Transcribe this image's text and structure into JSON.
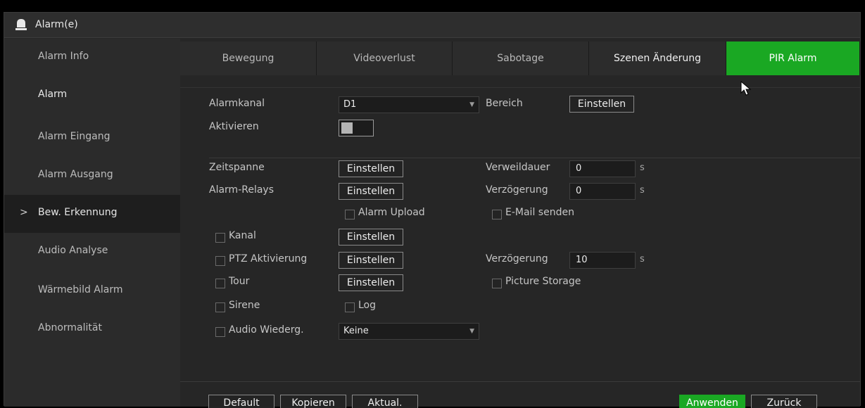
{
  "window": {
    "title": "Alarm(e)"
  },
  "sidebar": {
    "items": [
      {
        "label": "Alarm Info"
      },
      {
        "label": "Alarm"
      },
      {
        "label": "Alarm Eingang"
      },
      {
        "label": "Alarm Ausgang"
      },
      {
        "label": "Bew. Erkennung",
        "active": true
      },
      {
        "label": "Audio Analyse"
      },
      {
        "label": "Wärmebild Alarm"
      },
      {
        "label": "Abnormalität"
      }
    ],
    "active_marker": ">"
  },
  "tabs": [
    {
      "label": "Bewegung"
    },
    {
      "label": "Videoverlust"
    },
    {
      "label": "Sabotage"
    },
    {
      "label": "Szenen Änderung"
    },
    {
      "label": "PIR Alarm",
      "active": true
    }
  ],
  "form": {
    "alarmkanal": {
      "label": "Alarmkanal",
      "value": "D1"
    },
    "bereich": {
      "label": "Bereich",
      "button": "Einstellen"
    },
    "aktivieren": {
      "label": "Aktivieren",
      "enabled": false
    },
    "zeitspanne": {
      "label": "Zeitspanne",
      "button": "Einstellen"
    },
    "verweildauer": {
      "label": "Verweildauer",
      "value": "0",
      "unit": "s"
    },
    "alarm_relays": {
      "label": "Alarm-Relays",
      "button": "Einstellen"
    },
    "verzoegerung1": {
      "label": "Verzögerung",
      "value": "0",
      "unit": "s"
    },
    "alarm_upload": {
      "label": "Alarm Upload",
      "checked": false
    },
    "email": {
      "label": "E-Mail senden",
      "checked": false
    },
    "kanal": {
      "label": "Kanal",
      "checked": false,
      "button": "Einstellen"
    },
    "ptz": {
      "label": "PTZ Aktivierung",
      "checked": false,
      "button": "Einstellen"
    },
    "verzoegerung2": {
      "label": "Verzögerung",
      "value": "10",
      "unit": "s"
    },
    "tour": {
      "label": "Tour",
      "checked": false,
      "button": "Einstellen"
    },
    "picture_storage": {
      "label": "Picture Storage",
      "checked": false
    },
    "sirene": {
      "label": "Sirene",
      "checked": false
    },
    "log": {
      "label": "Log",
      "checked": false
    },
    "audio": {
      "label": "Audio Wiederg.",
      "checked": false,
      "value": "Keine"
    }
  },
  "footer": {
    "default": "Default",
    "kopieren": "Kopieren",
    "aktual": "Aktual.",
    "anwenden": "Anwenden",
    "zurueck": "Zurück"
  },
  "colors": {
    "accent": "#1aa823",
    "background": "#262626",
    "sidebar": "#2b2b2b"
  },
  "icons": {
    "title_icon": "alarm-bell-icon",
    "dropdown": "triangle-down-icon",
    "cursor": "mouse-pointer-icon"
  }
}
